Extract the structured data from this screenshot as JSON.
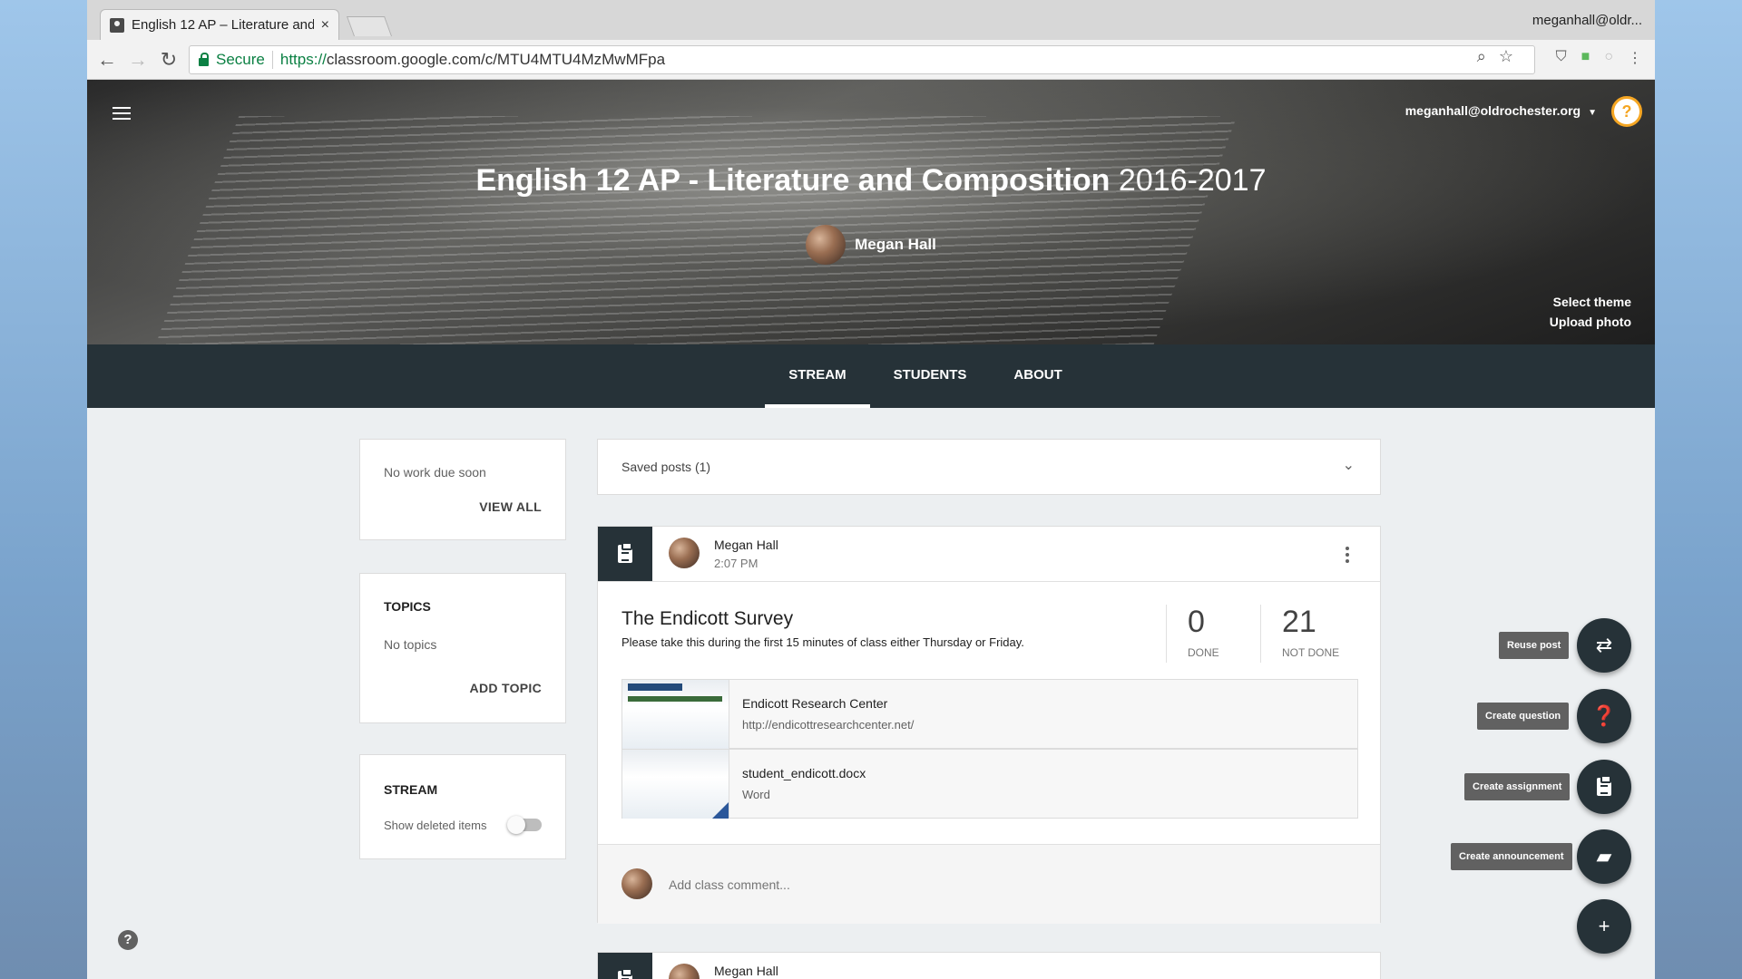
{
  "browser": {
    "tab_title": "English 12 AP – Literature and",
    "tab_close": "×",
    "profile": "meganhall@oldr...",
    "secure_label": "Secure",
    "url_scheme": "https://",
    "url_rest": "classroom.google.com/c/MTU4MTU4MzMwMFpa"
  },
  "header": {
    "account": "meganhall@oldrochester.org",
    "help_glyph": "?",
    "course_title_bold": "English 12 AP - Literature and Composition",
    "course_year": "2016-2017",
    "teacher": "Megan Hall",
    "select_theme": "Select theme",
    "upload_photo": "Upload photo"
  },
  "tabs": [
    {
      "label": "STREAM",
      "active": true
    },
    {
      "label": "STUDENTS",
      "active": false
    },
    {
      "label": "ABOUT",
      "active": false
    }
  ],
  "upcoming": {
    "text": "No work due soon",
    "view_all": "VIEW ALL"
  },
  "topics": {
    "title": "TOPICS",
    "empty": "No topics",
    "add": "ADD TOPIC"
  },
  "stream_settings": {
    "title": "STREAM",
    "label": "Show deleted items",
    "show_deleted": false
  },
  "saved_posts": {
    "label": "Saved posts (1)"
  },
  "post": {
    "author": "Megan Hall",
    "time": "2:07 PM",
    "title": "The Endicott Survey",
    "description": "Please take this during the first 15 minutes of class either Thursday or Friday.",
    "done_count": "0",
    "done_label": "DONE",
    "not_done_count": "21",
    "not_done_label": "NOT DONE",
    "attachments": [
      {
        "name": "Endicott Research Center",
        "sub": "http://endicottresearchcenter.net/"
      },
      {
        "name": "student_endicott.docx",
        "sub": "Word"
      }
    ],
    "comment_placeholder": "Add class comment..."
  },
  "next_post": {
    "author": "Megan Hall"
  },
  "fab_menu": {
    "reuse": "Reuse post",
    "question": "Create question",
    "assignment": "Create assignment",
    "announcement": "Create announcement",
    "plus": "+"
  },
  "colors": {
    "header_dark": "#263238",
    "secure_green": "#0b8043",
    "help_orange": "#f5a623"
  }
}
